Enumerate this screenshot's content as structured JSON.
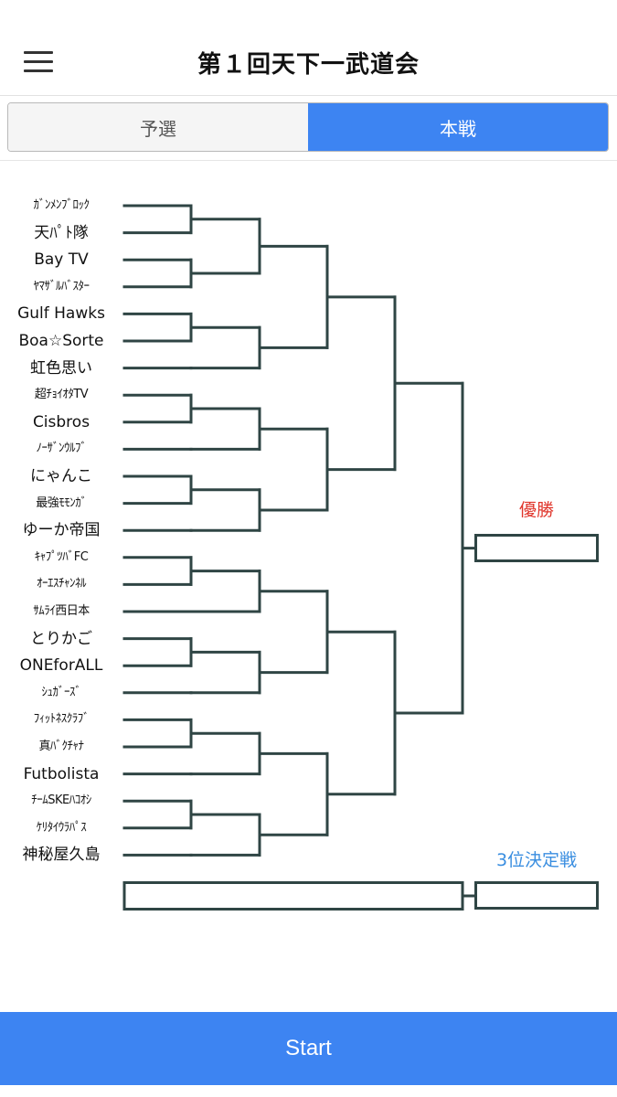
{
  "header": {
    "title": "第１回天下一武道会",
    "menu_icon": "hamburger-menu-icon"
  },
  "tabs": [
    {
      "label": "予選",
      "active": false
    },
    {
      "label": "本戦",
      "active": true
    }
  ],
  "bracket": {
    "teams": [
      "ｶﾞﾝﾒﾝﾌﾞﾛｯｸ",
      "天ﾊﾟﾄ隊",
      "Bay TV",
      "ﾔﾏｻﾞﾙﾊﾞｽﾀｰ",
      "Gulf Hawks",
      "Boa☆Sorte",
      "虹色思い",
      "超ﾁｮｲｵﾀTV",
      "Cisbros",
      "ﾉｰｻﾞﾝｳﾙﾌﾞ",
      "にゃんこ",
      "最強ﾓﾓﾝｶﾞ",
      "ゆーか帝国",
      "ｷｬﾌﾟﾂﾊﾞFC",
      "ｵｰｴｽﾁｬﾝﾈﾙ",
      "ｻﾑﾗｲ西日本",
      "とりかご",
      "ONEforALL",
      "ｼｭｶﾞｰｽﾞ",
      "ﾌｨｯﾄﾈｽｸﾗﾌﾞ",
      "真ﾊﾞｸﾁｬﾅ",
      "Futbolista",
      "ﾁｰﾑSKEﾊｺｵｼ",
      "ｹﾘﾀｲｳﾗﾊﾟｽ",
      "神秘屋久島"
    ],
    "champion_label": "優勝",
    "third_place_label": "3位決定戦",
    "champion_color": "#e0352b",
    "third_place_color": "#3a8ee0",
    "line_color": "#2f4544"
  },
  "start_button": {
    "label": "Start"
  },
  "accent_color": "#3d84f2"
}
